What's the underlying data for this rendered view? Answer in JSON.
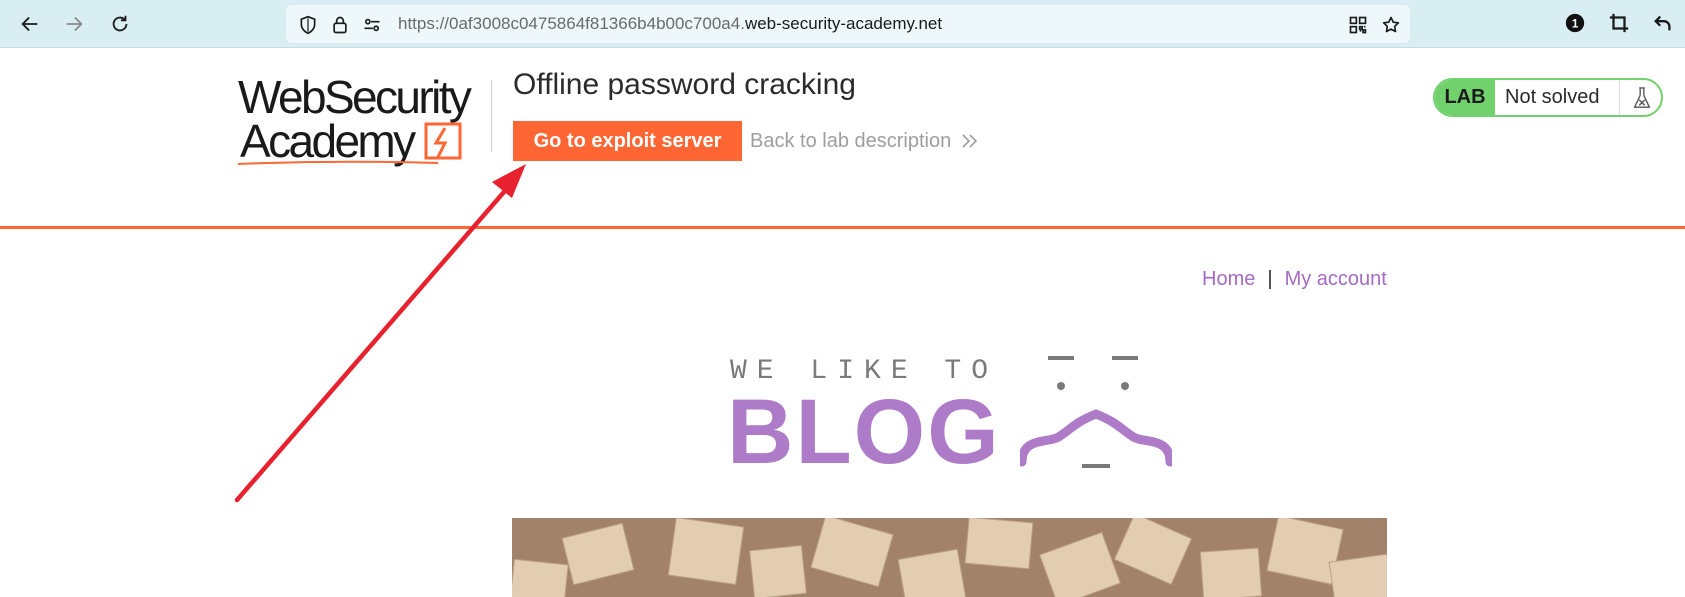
{
  "browser": {
    "url_prefix": "https://0af3008c0475864f81366b4b00c700a4.",
    "url_host": "web-security-academy.net",
    "notification_count": "1",
    "icons": [
      "back-arrow-icon",
      "forward-arrow-icon",
      "reload-icon",
      "shield-icon",
      "lock-icon",
      "permissions-icon",
      "qr-code-icon",
      "bookmark-star-icon",
      "extension-badge-icon",
      "crop-icon",
      "undo-icon"
    ]
  },
  "header": {
    "logo_line1": "WebSecurity",
    "logo_line2": "Academy",
    "lab_title": "Offline password cracking",
    "exploit_button": "Go to exploit server",
    "back_link": "Back to lab description"
  },
  "lab_status": {
    "label": "LAB",
    "status": "Not solved",
    "accent": "#70d16d"
  },
  "blog_nav": {
    "home": "Home",
    "separator": "|",
    "account": "My account"
  },
  "banner": {
    "tagline": "WE LIKE TO",
    "word": "BLOG"
  },
  "colors": {
    "brand_orange": "#ff6633",
    "link_purple": "#a56bc2",
    "annotation_red": "#e8212e"
  }
}
